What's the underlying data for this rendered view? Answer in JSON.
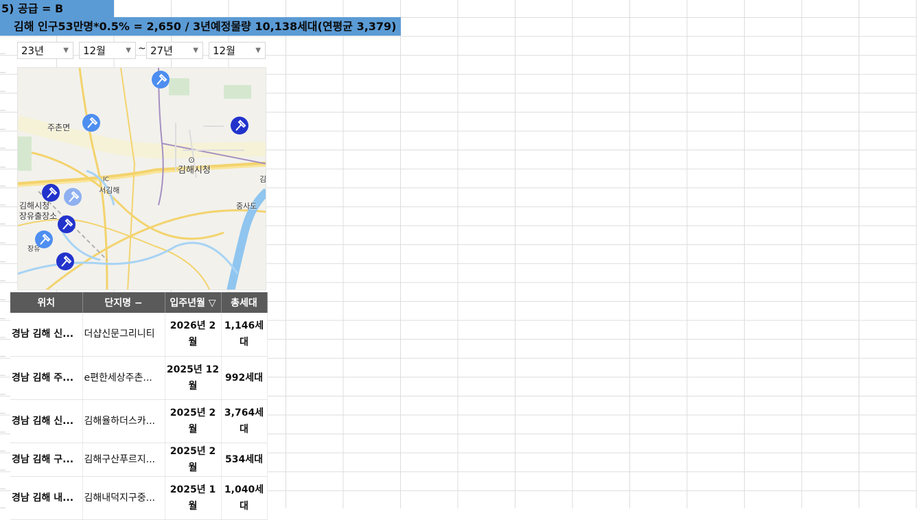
{
  "title_line1": "5) 공급 = B",
  "title_line2": "김해 인구53만명*0.5% = 2,650 / 3년예정물량 10,138세대(연평균 3,379)",
  "filters": {
    "from_year": "23년",
    "from_month": "12월",
    "separator": "~",
    "to_year": "27년",
    "to_month": "12월"
  },
  "map": {
    "labels": {
      "juchon": "주촌면",
      "city_hall": "김해시청",
      "seogimhae": "서김해",
      "ic": "IC",
      "junsado": "중사도",
      "place_line1": "김해시청",
      "place_line2": "장유출장소",
      "jangyu": "장유",
      "edge": "김"
    },
    "pin_icon": "auction-hammer-icon",
    "colors": {
      "pin_dark": "#2233cc",
      "pin_light": "#4d8ef0",
      "pin_faded": "#8fb0f0"
    }
  },
  "table": {
    "headers": [
      "위치",
      "단지명 −",
      "입주년월 ▽",
      "총세대"
    ],
    "rows": [
      [
        "경남 김해 신...",
        "더샵신문그리니티",
        "2026년 2월",
        "1,146세대"
      ],
      [
        "경남 김해 주...",
        "e편한세상주촌...",
        "2025년 12월",
        "992세대"
      ],
      [
        "경남 김해 신...",
        "김해율하더스카...",
        "2025년 2월",
        "3,764세대"
      ],
      [
        "경남 김해 구...",
        "김해구산푸르지...",
        "2025년 2월",
        "534세대"
      ],
      [
        "경남 김해 내...",
        "김해내덕지구중...",
        "2025년 1월",
        "1,040세대"
      ]
    ]
  }
}
